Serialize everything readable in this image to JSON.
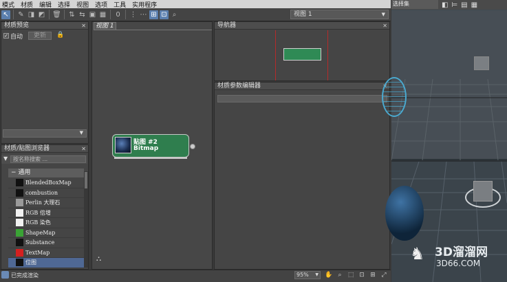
{
  "menubar": {
    "items": [
      "模式",
      "材质",
      "编辑",
      "选择",
      "视图",
      "选项",
      "工具",
      "实用程序"
    ]
  },
  "toolbar": {
    "view_select": "视图 1"
  },
  "preview_panel": {
    "title": "材质预览",
    "auto_label": "自动",
    "update_label": "更新"
  },
  "browser_panel": {
    "title": "材质/贴图浏览器",
    "search_placeholder": "按名称搜索 ...",
    "category": "通用",
    "items": [
      {
        "label": "BlendedBoxMap",
        "icon_color": "#111111"
      },
      {
        "label": "combustion",
        "icon_color": "#111111"
      },
      {
        "label": "Perlin 大理石",
        "icon_color": "#9a9a9a"
      },
      {
        "label": "RGB 倍增",
        "icon_color": "#f2f2f2"
      },
      {
        "label": "RGB 染色",
        "icon_color": "#f2f2f2"
      },
      {
        "label": "ShapeMap",
        "icon_color": "#3aa335"
      },
      {
        "label": "Substance",
        "icon_color": "#111111"
      },
      {
        "label": "TextMap",
        "icon_color": "#d42020"
      },
      {
        "label": "位图",
        "icon_color": "#111111"
      }
    ],
    "selected_index": 8
  },
  "view_panel": {
    "tab": "视图 1",
    "node": {
      "title": "贴图 #2",
      "subtitle": "Bitmap"
    }
  },
  "navigator_panel": {
    "title": "导航器"
  },
  "param_panel": {
    "title": "材质参数编辑器"
  },
  "status": {
    "text": "已完成渲染",
    "zoom": "95%"
  },
  "viewport": {
    "dropdown": "选择集",
    "watermark_cn": "3D溜溜网",
    "watermark_url": "3D66.COM"
  },
  "colors": {
    "node_green": "#2f7e4e",
    "selection_blue": "#4f6894",
    "nav_frame": "#b52b2b"
  }
}
